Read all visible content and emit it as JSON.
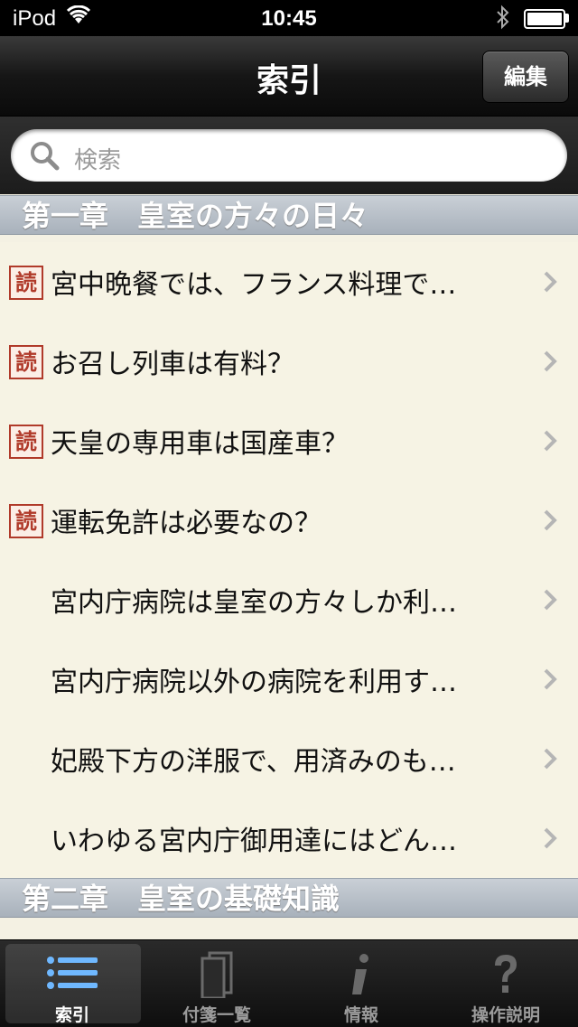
{
  "status": {
    "carrier": "iPod",
    "time": "10:45"
  },
  "nav": {
    "title": "索引",
    "edit_label": "編集"
  },
  "search": {
    "placeholder": "検索"
  },
  "sections": [
    {
      "title": "第一章　皇室の方々の日々"
    },
    {
      "title": "第二章　皇室の基礎知識"
    }
  ],
  "badge_text": "読",
  "rows": [
    {
      "label": "宮中晩餐では、フランス料理で…",
      "read": true
    },
    {
      "label": "お召し列車は有料？",
      "read": true
    },
    {
      "label": "天皇の専用車は国産車？",
      "read": true
    },
    {
      "label": "運転免許は必要なの？",
      "read": true
    },
    {
      "label": "宮内庁病院は皇室の方々しか利…",
      "read": false
    },
    {
      "label": "宮内庁病院以外の病院を利用す…",
      "read": false
    },
    {
      "label": "妃殿下方の洋服で、用済みのも…",
      "read": false
    },
    {
      "label": "いわゆる宮内庁御用達にはどん…",
      "read": false
    }
  ],
  "tabs": [
    {
      "label": "索引",
      "icon": "list-icon",
      "active": true
    },
    {
      "label": "付箋一覧",
      "icon": "sticky-notes-icon",
      "active": false
    },
    {
      "label": "情報",
      "icon": "info-icon",
      "active": false
    },
    {
      "label": "操作説明",
      "icon": "help-icon",
      "active": false
    }
  ],
  "colors": {
    "accent_red": "#b03a2a",
    "section_blue_gray": "#a8b1bb",
    "row_bg": "#f6f3e4"
  }
}
